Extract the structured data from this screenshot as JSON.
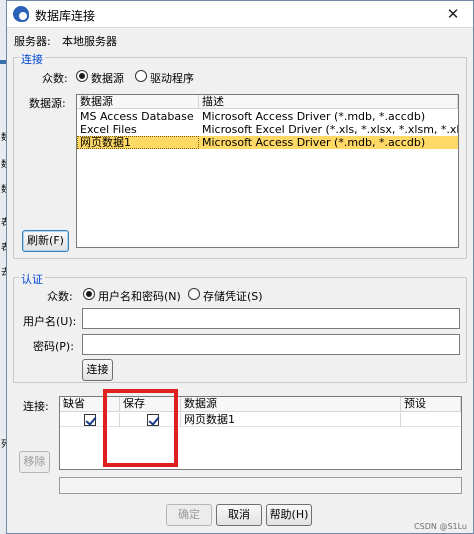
{
  "window": {
    "title": "数据库连接",
    "close_glyph": "✕"
  },
  "server": {
    "label": "服务器:",
    "value": "本地服务器"
  },
  "connect_group": {
    "legend": "连接",
    "mode_label": "众数:",
    "options": [
      "数据源",
      "驱动程序"
    ],
    "selected": 0,
    "datasource_label": "数据源:",
    "columns": [
      "数据源",
      "描述"
    ],
    "rows": [
      [
        "MS Access Database",
        "Microsoft Access Driver (*.mdb, *.accdb)"
      ],
      [
        "Excel Files",
        "Microsoft Excel Driver (*.xls, *.xlsx, *.xlsm, *.xlsb)"
      ],
      [
        "网页数据1",
        "Microsoft Access Driver (*.mdb, *.accdb)"
      ]
    ],
    "selected_row": 2,
    "refresh_button": "刷新(F)"
  },
  "auth_group": {
    "legend": "认证",
    "mode_label": "众数:",
    "options": [
      "用户名和密码(N)",
      "存储凭证(S)"
    ],
    "selected": 0,
    "username_label": "用户名(U):",
    "password_label": "密码(P):",
    "username_value": "",
    "password_value": "",
    "connect_button": "连接"
  },
  "connections": {
    "label": "连接:",
    "columns": [
      "缺省",
      "保存",
      "数据源",
      "预设"
    ],
    "rows": [
      {
        "default": true,
        "save": true,
        "datasource": "网页数据1",
        "preset": ""
      }
    ],
    "remove_button": "移除"
  },
  "footer": {
    "ok_button": "确定",
    "cancel_button": "取消",
    "help_button": "帮助(H)"
  },
  "left_strip": [
    "数",
    "数",
    "数",
    "表",
    "表",
    "去",
    "列"
  ],
  "watermark": "CSDN @S1Lu"
}
